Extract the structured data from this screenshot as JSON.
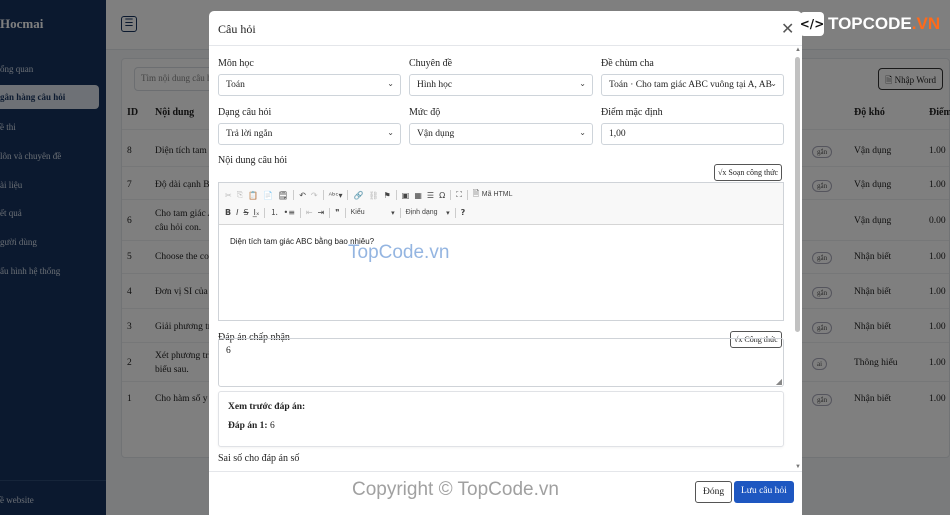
{
  "sidebar": {
    "brand": "Hocmai",
    "items": [
      {
        "label": "ổng quan"
      },
      {
        "label": "gân hàng câu hỏi"
      },
      {
        "label": "ề thi"
      },
      {
        "label": "lôn và chuyên đề"
      },
      {
        "label": "ài liệu"
      },
      {
        "label": "ết quả"
      },
      {
        "label": "gười dùng"
      },
      {
        "label": "ấu hình hệ thống"
      }
    ],
    "footer_link": "ề website"
  },
  "background": {
    "search_placeholder": "Tìm nội dung câu h",
    "import_label": "Nhập Word",
    "columns": {
      "id": "ID",
      "content": "Nội dung",
      "level": "Độ khó",
      "score": "Điểm"
    },
    "rows": [
      {
        "id": "8",
        "content": "Diện tích tam g",
        "badge": "gắn",
        "level": "Vận dụng",
        "score": "1.00"
      },
      {
        "id": "7",
        "content": "Độ dài cạnh BC",
        "badge": "gắn",
        "level": "Vận dụng",
        "score": "1.00"
      },
      {
        "id": "6",
        "content": "Cho tam giác A",
        "content2": "câu hỏi con.",
        "badge": "",
        "level": "Vận dụng",
        "score": "0.00"
      },
      {
        "id": "5",
        "content": "Choose the cor",
        "badge": "gắn",
        "level": "Nhận biết",
        "score": "1.00"
      },
      {
        "id": "4",
        "content": "Đơn vị SI của l",
        "badge": "gắn",
        "level": "Nhận biết",
        "score": "1.00"
      },
      {
        "id": "3",
        "content": "Giải phương tr",
        "badge": "gắn",
        "level": "Nhận biết",
        "score": "1.00"
      },
      {
        "id": "2",
        "content": "Xét phương trì",
        "content2": "biểu sau.",
        "badge": "ai",
        "level": "Thông hiểu",
        "score": "1.00"
      },
      {
        "id": "1",
        "content": "Cho hàm số y",
        "badge": "gắn",
        "level": "Nhận biết",
        "score": "1.00"
      }
    ]
  },
  "watermarks": {
    "logo_prefix": "TOPCODE",
    "logo_suffix": ".VN",
    "center": "TopCode.vn",
    "bottom": "Copyright © TopCode.vn"
  },
  "modal": {
    "title": "Câu hỏi",
    "fields": {
      "subject": {
        "label": "Môn học",
        "value": "Toán"
      },
      "topic": {
        "label": "Chuyên đề",
        "value": "Hình học"
      },
      "parent": {
        "label": "Đề chùm cha",
        "value": "Toán · Cho tam giác ABC vuông tại A, AB"
      },
      "qtype": {
        "label": "Dạng câu hỏi",
        "value": "Trả lời ngắn"
      },
      "level": {
        "label": "Mức độ",
        "value": "Vận dụng"
      },
      "score": {
        "label": "Điểm mặc định",
        "value": "1,00"
      }
    },
    "content_label": "Nội dung câu hỏi",
    "formula_button": "Soạn công thức",
    "toolbar": {
      "source": "Mã HTML",
      "style": "Kiểu",
      "format": "Định dạng",
      "help": "?"
    },
    "content_text": "Diện tích tam giác ABC bằng bao nhiêu?",
    "accepted_label": "Đáp án chấp nhận",
    "accepted_formula_button": "Công thức",
    "accepted_value": "6",
    "preview": {
      "title": "Xem trước đáp án:",
      "answer_label": "Đáp án 1:",
      "answer_value": "6"
    },
    "tolerance_label": "Sai số cho đáp án số",
    "close_button": "Đóng",
    "save_button": "Lưu câu hỏi"
  }
}
